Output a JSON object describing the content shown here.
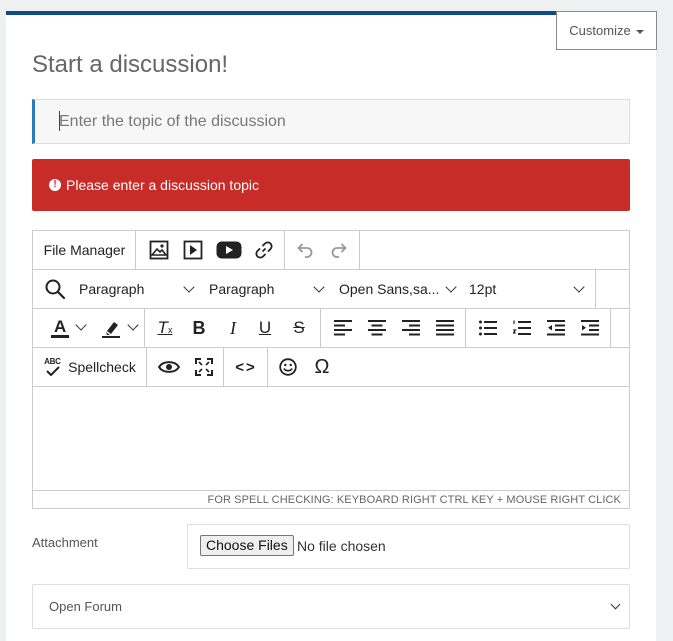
{
  "header": {
    "customize_label": "Customize",
    "title": "Start a discussion!"
  },
  "topic": {
    "placeholder": "Enter the topic of the discussion",
    "value": ""
  },
  "alert": {
    "message": "Please enter a discussion topic"
  },
  "toolbar": {
    "file_manager": "File Manager",
    "block_format": "Paragraph",
    "paragraph": "Paragraph",
    "font_family": "Open Sans,sa...",
    "font_size": "12pt",
    "spellcheck": "Spellcheck",
    "abc_glyph": "ABC",
    "text_color_letter": "A",
    "bold": "B",
    "italic": "I",
    "underline": "U",
    "strike": "S",
    "clear_format": "T",
    "omega": "Ω",
    "code": "<>"
  },
  "editor": {
    "status_text": "FOR SPELL CHECKING: KEYBOARD RIGHT CTRL KEY + MOUSE RIGHT CLICK"
  },
  "attachment": {
    "label": "Attachment",
    "button_label": "Choose Files",
    "status": "No file chosen"
  },
  "forum": {
    "selected": "Open Forum"
  },
  "colors": {
    "accent_bar": "#0f4a86",
    "alert_bg": "#c82c29",
    "topic_border": "#2b7bb9"
  }
}
